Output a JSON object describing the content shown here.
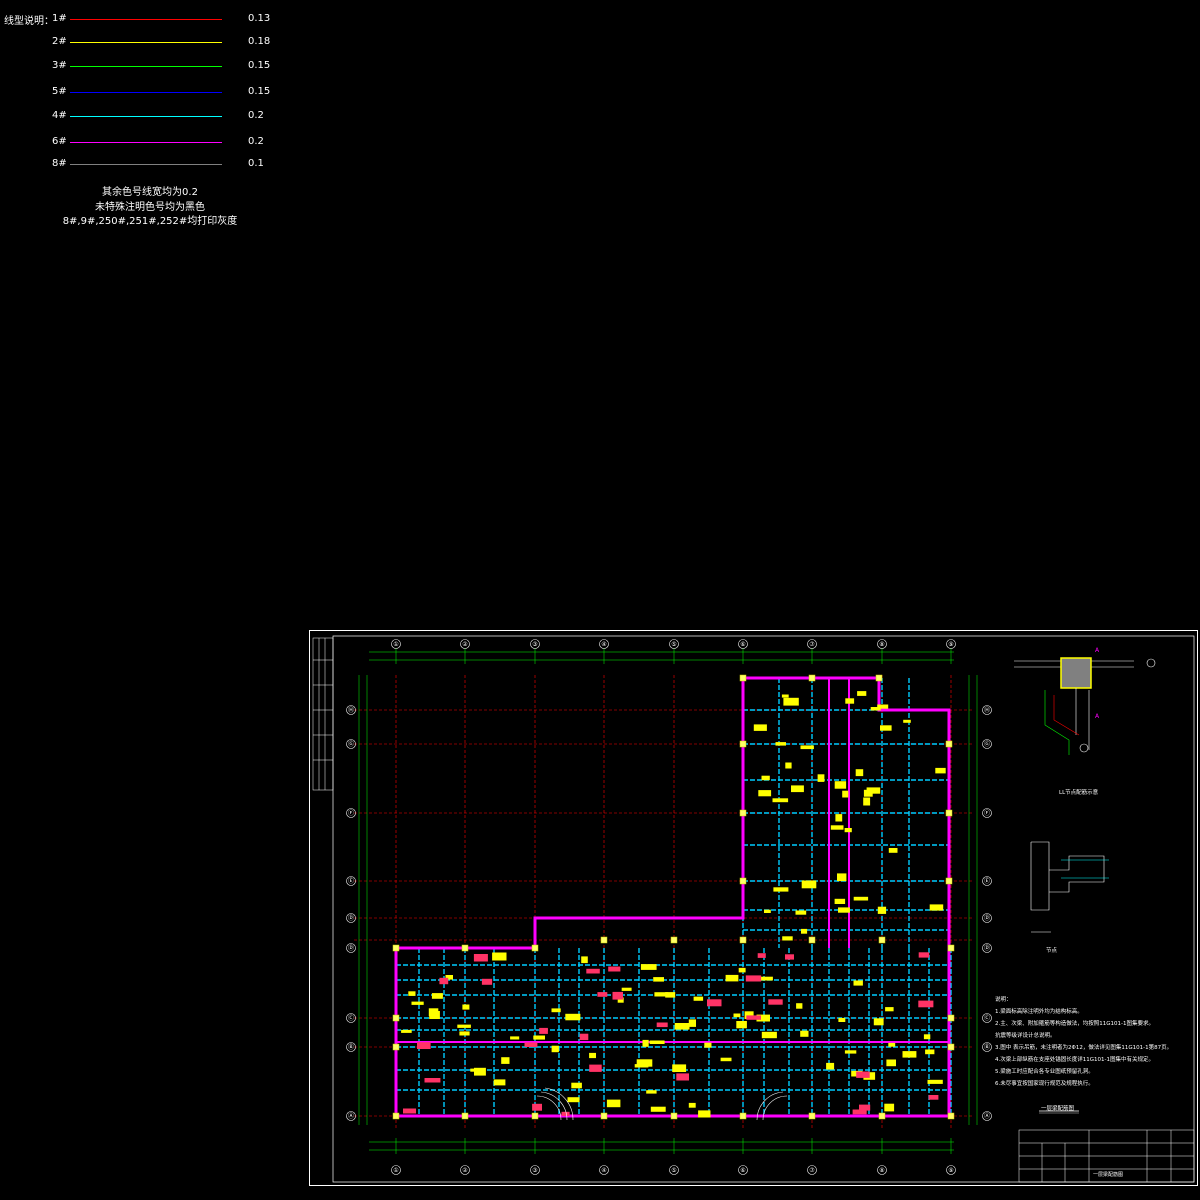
{
  "legend": {
    "title": "线型说明：",
    "rows": [
      {
        "no": "1#",
        "value": "0.13",
        "color": "#ff0000"
      },
      {
        "no": "2#",
        "value": "0.18",
        "color": "#ffff00"
      },
      {
        "no": "3#",
        "value": "0.15",
        "color": "#00ff00"
      },
      {
        "no": "5#",
        "value": "0.15",
        "color": "#0000ff"
      },
      {
        "no": "4#",
        "value": "0.2",
        "color": "#00ffff"
      },
      {
        "no": "6#",
        "value": "0.2",
        "color": "#ff00ff"
      },
      {
        "no": "8#",
        "value": "0.1",
        "color": "#808080"
      }
    ],
    "note1": "其余色号线宽均为0.2",
    "note2": "未特殊注明色号均为黑色",
    "note3": "8#,9#,250#,251#,252#均打印灰度"
  },
  "drawing": {
    "detail1_title": "LL节点配筋示意",
    "detail2_title": "节点",
    "plan_title": "一层梁配筋图",
    "notes_heading": "说明：",
    "notes": [
      "1.梁面标高除注明外均为结构标高。",
      "2.主、次梁、附加箍筋等构造做法，均按照11G101-1图集要求。",
      "  抗震等级详设计总说明。",
      "3.图中  表示吊筋，未注明者为2Φ12，做法详见图集11G101-1第87页。",
      "4.次梁上部纵筋在支座处锚固长度详11G101-1图集中有关规定。",
      "5.梁施工时应配合各专业图纸预留孔洞。",
      "6.未尽事宜按国家现行规范及规程执行。"
    ],
    "title_block_name": "一层梁配筋图",
    "axis_nums": [
      "①",
      "②",
      "③",
      "④",
      "⑤",
      "⑥",
      "⑦",
      "⑧",
      "⑨"
    ],
    "row_labels": [
      "Ⓗ",
      "Ⓖ",
      "Ⓕ",
      "Ⓔ",
      "Ⓓ",
      "Ⓒ",
      "Ⓑ",
      "Ⓐ"
    ],
    "colors": {
      "grid": "#ff0000",
      "beam": "#00ccff",
      "wall": "#ff00ff",
      "annot": "#ffff00",
      "dim": "#00ff00",
      "frame": "#ffffff"
    }
  }
}
